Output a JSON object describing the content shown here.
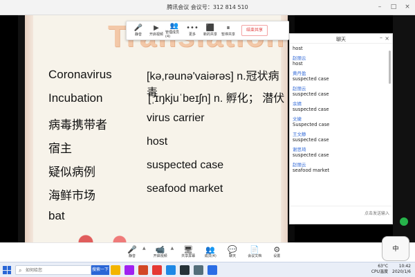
{
  "window": {
    "title": "腾讯会议 会议号：312 814 510"
  },
  "overlay_toolbar": {
    "items": [
      {
        "label": "静音",
        "icon": "microphone-icon"
      },
      {
        "label": "开启视频",
        "icon": "video-icon"
      },
      {
        "label": "管理成员(4)",
        "icon": "members-icon"
      },
      {
        "label": "更多",
        "icon": "more-icon"
      },
      {
        "label": "新的共享",
        "icon": "share-icon"
      },
      {
        "label": "暂停共享",
        "icon": "pause-share-icon"
      }
    ],
    "end_label": "结束共享"
  },
  "slide": {
    "heading": "Translation:",
    "rows": [
      {
        "term": "Coronavirus",
        "definition": "[kə,rəunə'vaiərəs] n.冠状病毒"
      },
      {
        "term": "Incubation",
        "definition": "[ˌɪŋkjuˈbeɪʃn] n. 孵化； 潜伏"
      },
      {
        "term": "病毒携带者",
        "definition": "virus carrier"
      },
      {
        "term": "宿主",
        "definition": "host"
      },
      {
        "term": "疑似病例",
        "definition": "suspected case"
      },
      {
        "term": "海鲜市场",
        "definition": "seafood market"
      },
      {
        "term": "bat",
        "definition": ""
      }
    ]
  },
  "chat": {
    "title": "聊天",
    "messages": [
      {
        "sender": "",
        "text": "host"
      },
      {
        "sender": "赵丽云",
        "text": "host"
      },
      {
        "sender": "黄丹盈",
        "text": "suspected case"
      },
      {
        "sender": "赵丽云",
        "text": "suspected case"
      },
      {
        "sender": "余婧",
        "text": "suspected case"
      },
      {
        "sender": "文婕",
        "text": "Suspected case"
      },
      {
        "sender": "王文静",
        "text": "suspected case"
      },
      {
        "sender": "谢思琦",
        "text": "suspected case"
      },
      {
        "sender": "赵丽云",
        "text": "seafood market"
      }
    ],
    "input_placeholder": "点击发送输入"
  },
  "bottom_controls": {
    "items": [
      {
        "label": "静音",
        "icon": "microphone-icon"
      },
      {
        "label": "开启视频",
        "icon": "video-icon"
      },
      {
        "label": "共享屏幕",
        "icon": "share-screen-icon"
      },
      {
        "label": "成员(4)",
        "icon": "members-icon"
      },
      {
        "label": "聊天",
        "icon": "chat-icon"
      },
      {
        "label": "会议文档",
        "icon": "doc-icon"
      },
      {
        "label": "设置",
        "icon": "settings-icon"
      }
    ],
    "corner_label": "中"
  },
  "taskbar": {
    "search_placeholder": "如何给您",
    "active_app": "搜索一下",
    "apps": [
      {
        "name": "windows-explorer-icon",
        "color": "#f3b400"
      },
      {
        "name": "premiere-icon",
        "color": "#a020f0"
      },
      {
        "name": "powerpoint-icon",
        "color": "#d24726"
      },
      {
        "name": "red-app-icon",
        "color": "#e53935"
      },
      {
        "name": "qq-icon",
        "color": "#1e88e5"
      },
      {
        "name": "game-icon",
        "color": "#263238"
      },
      {
        "name": "camera-icon",
        "color": "#546e7a"
      },
      {
        "name": "tencent-meeting-icon",
        "color": "#2b6de5"
      }
    ],
    "cpu_temp": "63°C",
    "cpu_label": "CPU温度",
    "time": "10:42",
    "date": "2020/1/6"
  }
}
